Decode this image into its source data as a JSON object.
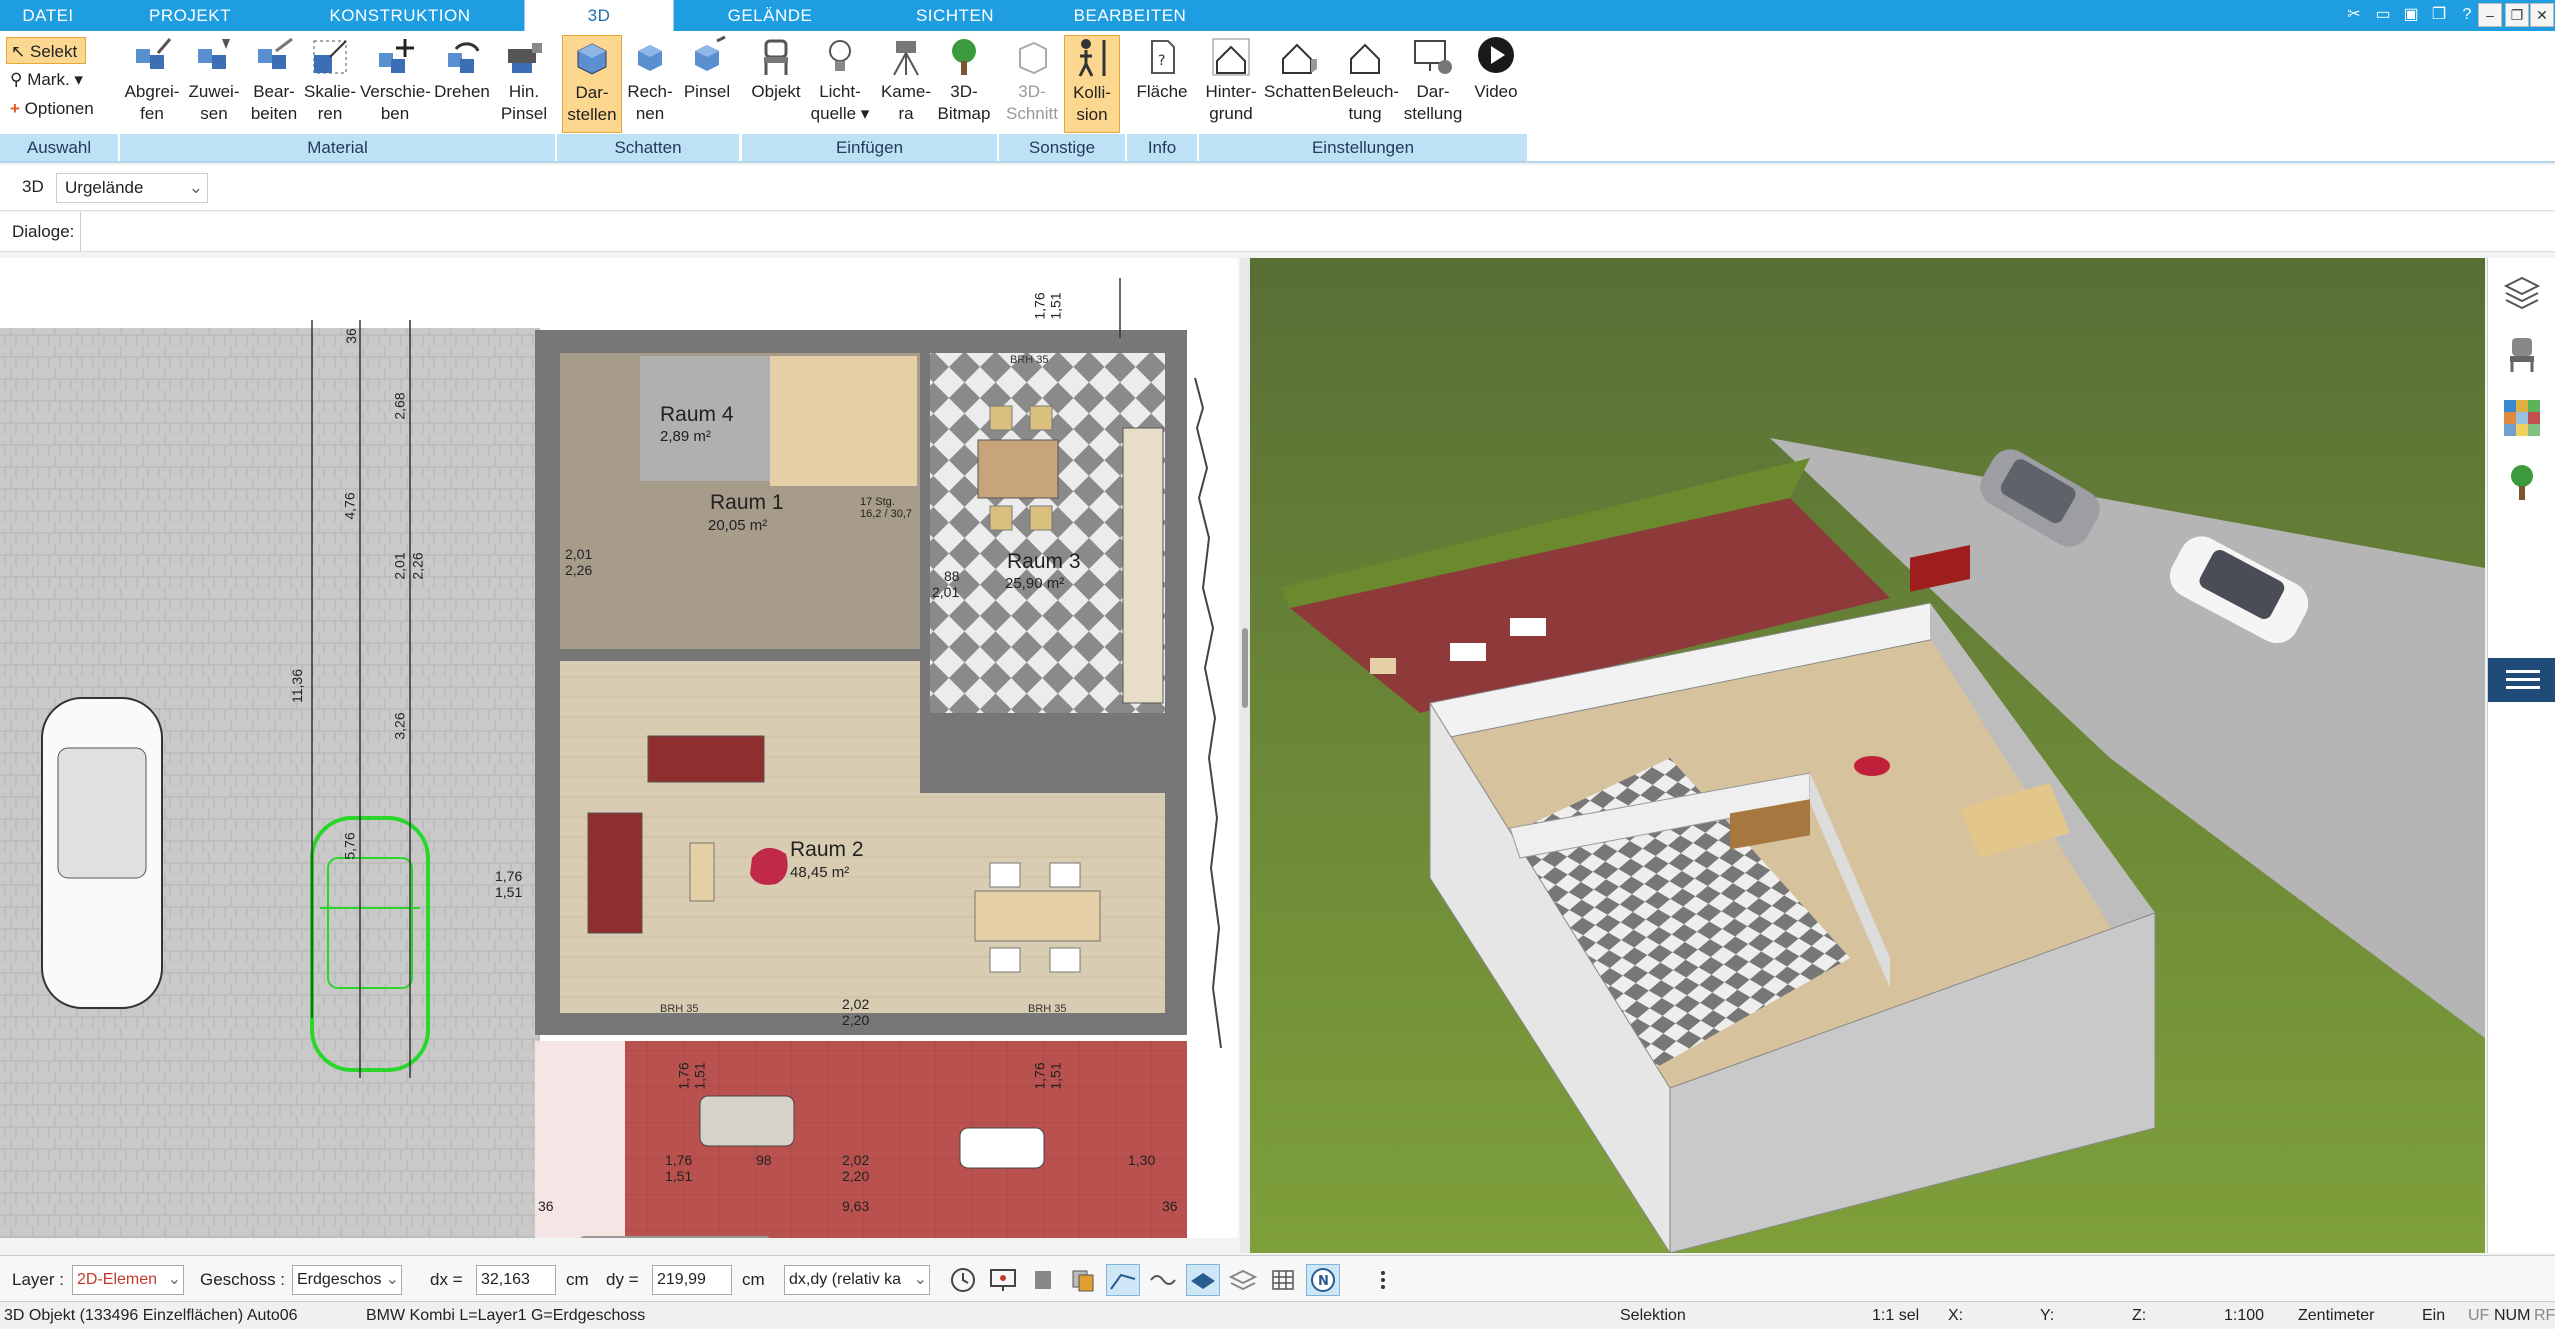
{
  "tabs": [
    "DATEI",
    "PROJEKT",
    "KONSTRUKTION",
    "3D",
    "GELÄNDE",
    "SICHTEN",
    "BEARBEITEN"
  ],
  "active_tab": "3D",
  "selection_tools": {
    "selekt": "Selekt",
    "mark": "Mark.",
    "optionen": "Optionen",
    "group": "Auswahl"
  },
  "ribbon": {
    "material": {
      "group": "Material",
      "buttons": [
        "Abgrei-\nfen",
        "Zuwei-\nsen",
        "Bear-\nbeiten",
        "Skalie-\nren",
        "Verschie-\nben",
        "Drehen",
        "Hin.\nPinsel"
      ]
    },
    "schatten": {
      "group": "Schatten",
      "buttons": [
        "Dar-\nstellen",
        "Rech-\nnen",
        "Pinsel"
      ]
    },
    "einfuegen": {
      "group": "Einfügen",
      "buttons": [
        "Objekt",
        "Licht-\nquelle ▾",
        "Kame-\nra",
        "3D-\nBitmap"
      ]
    },
    "sonstige": {
      "group": "Sonstige",
      "buttons": [
        "3D-\nSchnitt",
        "Kolli-\nsion"
      ]
    },
    "info": {
      "group": "Info",
      "buttons": [
        "Fläche"
      ]
    },
    "einstellungen": {
      "group": "Einstellungen",
      "buttons": [
        "Hinter-\ngrund",
        "Schatten",
        "Beleuch-\ntung",
        "Dar-\nstellung",
        "Video"
      ]
    }
  },
  "row3d": {
    "label": "3D",
    "select": "Urgelände"
  },
  "dialogs": {
    "label": "Dialoge:"
  },
  "plan": {
    "rooms": [
      {
        "name": "Raum 4",
        "area": "2,89 m²"
      },
      {
        "name": "Raum 1",
        "area": "20,05 m²"
      },
      {
        "name": "Raum 3",
        "area": "25,90 m²"
      },
      {
        "name": "Raum 2",
        "area": "48,45 m²"
      }
    ],
    "stairs": "17 Stg.\n16,2 / 30,7",
    "dims": {
      "d1": "36",
      "d2": "2,68",
      "d3": "4,76",
      "d4": "2,01",
      "d5": "2,26",
      "d6": "11,36",
      "d7": "3,26",
      "d8": "5,76",
      "d9": "1,76",
      "d10": "1,51",
      "d11": "1,76",
      "d12": "1,51",
      "d13": "2,01",
      "d14": "2,26",
      "d15": "88",
      "d16": "2,01",
      "d17": "2,02",
      "d18": "2,20",
      "d19": "1,76",
      "d20": "1,51",
      "d21": "1,30",
      "d22": "9,63",
      "d23": "36",
      "d24": "98",
      "d25": "1,76",
      "d26": "1,51",
      "d27": "2,02",
      "d28": "2,20",
      "d29": "1,76",
      "d30": "1,51",
      "d31": "36"
    },
    "brh": "BRH 35"
  },
  "propbar": {
    "layer_label": "Layer :",
    "layer_value": "2D-Elemen",
    "geschoss_label": "Geschoss :",
    "geschoss_value": "Erdgeschos",
    "dx_label": "dx =",
    "dx_value": "32,163",
    "dx_unit": "cm",
    "dy_label": "dy =",
    "dy_value": "219,99",
    "dy_unit": "cm",
    "mode_value": "dx,dy (relativ ka"
  },
  "status": {
    "object": "3D Objekt (133496 Einzelflächen) Auto06",
    "info": "BMW Kombi L=Layer1 G=Erdgeschoss",
    "mode": "Selektion",
    "scale_sel": "1:1 sel",
    "x": "X:",
    "y": "Y:",
    "z": "Z:",
    "scale": "1:100",
    "unit": "Zentimeter",
    "ein": "Ein",
    "uf": "UF",
    "num": "NUM",
    "rf": "RF"
  },
  "colors": {
    "accent": "#1e9ee0",
    "group_bg": "#bfe1f6",
    "selected": "#fcd790"
  }
}
